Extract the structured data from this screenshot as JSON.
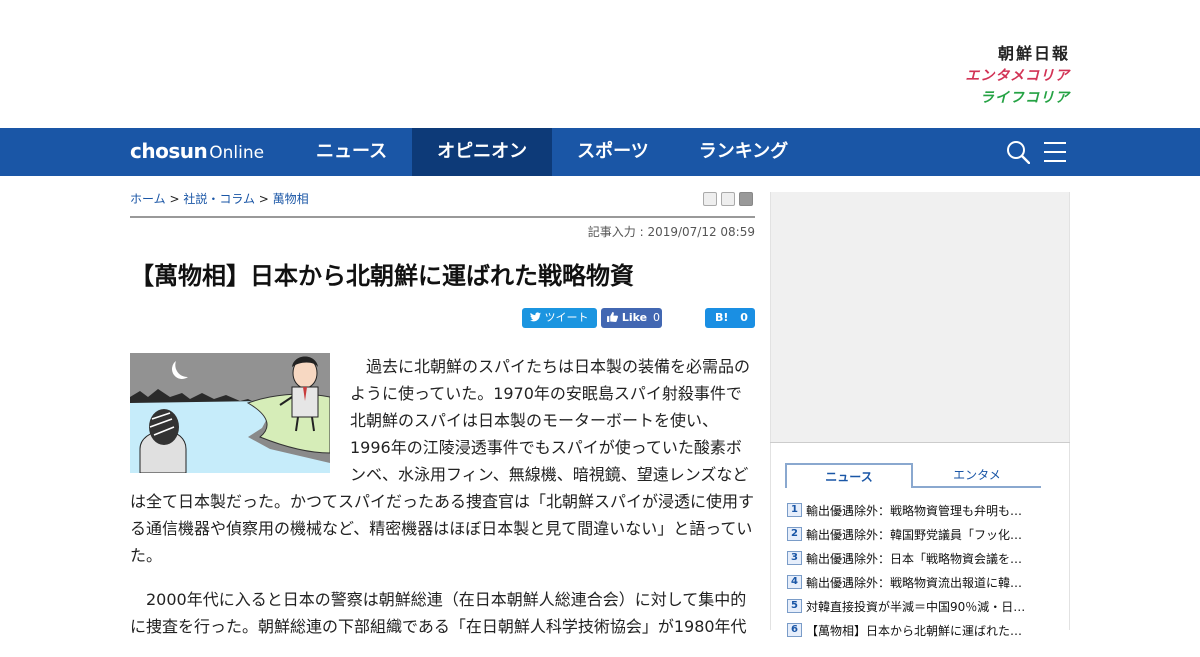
{
  "brands": {
    "main": "朝鮮日報",
    "entame": "エンタメコリア",
    "life": "ライフコリア"
  },
  "nav": {
    "logo_bold": "chosun",
    "logo_light": "Online",
    "items": [
      {
        "label": "ニュース"
      },
      {
        "label": "オピニオン",
        "active": true
      },
      {
        "label": "スポーツ"
      },
      {
        "label": "ランキング"
      }
    ],
    "icons": [
      "search-icon",
      "menu-icon"
    ],
    "bar_color": "#1a56a6",
    "active_color": "#0d3a78"
  },
  "breadcrumb": {
    "home": "ホーム",
    "sep": " > ",
    "section": "社説・コラム",
    "column": "萬物相"
  },
  "article": {
    "date": "記事入力 : 2019/07/12 08:59",
    "title": "【萬物相】日本から北朝鮮に運ばれた戦略物資",
    "share": {
      "tweet": "ツイート",
      "like": "Like",
      "like_count": "0",
      "hatena": "B!",
      "hatena_count": "0"
    },
    "paragraphs": [
      "　過去に北朝鮮のスパイたちは日本製の装備を必需品のように使っていた。1970年の安眠島スパイ射殺事件で北朝鮮のスパイは日本製のモーターボートを使い、1996年の江陵浸透事件でもスパイが使っていた酸素ボンベ、水泳用フィン、無線機、暗視鏡、望遠レンズなどは全て日本製だった。かつてスパイだったある捜査官は「北朝鮮スパイが浸透に使用する通信機器や偵察用の機械など、精密機器はほぼ日本製と見て間違いない」と語っていた。",
      "　2000年代に入ると日本の警察は朝鮮総連（在日本朝鮮人総連合会）に対して集中的に捜査を行った。朝鮮総連の下部組織である「在日朝鮮人科学技術協会」が1980年代"
    ]
  },
  "sidebar": {
    "tabs": [
      {
        "label": "ニュース",
        "active": true
      },
      {
        "label": "エンタメ"
      }
    ],
    "news": [
      {
        "num": "1",
        "title": "輸出優遇除外：戦略物資管理も弁明も…"
      },
      {
        "num": "2",
        "title": "輸出優遇除外：韓国野党議員「フッ化…"
      },
      {
        "num": "3",
        "title": "輸出優遇除外：日本「戦略物資会議を…"
      },
      {
        "num": "4",
        "title": "輸出優遇除外：戦略物資流出報道に韓…"
      },
      {
        "num": "5",
        "title": "対韓直接投資が半減＝中国90％減・日…"
      },
      {
        "num": "6",
        "title": "【萬物相】日本から北朝鮮に運ばれた…"
      }
    ]
  }
}
